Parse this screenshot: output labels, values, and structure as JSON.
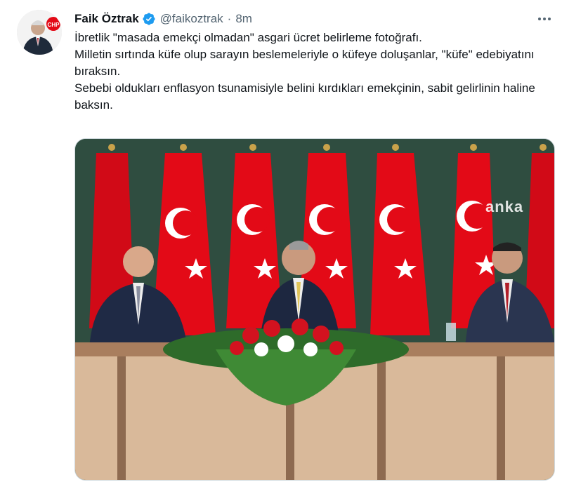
{
  "author": {
    "name": "Faik Öztrak",
    "handle": "@faikoztrak",
    "time": "8m",
    "separator": "·",
    "avatar_badge": "CHP",
    "verified": true
  },
  "tweet": {
    "lines": [
      "İbretlik \"masada emekçi olmadan\" asgari ücret belirleme fotoğrafı.",
      "Milletin sırtında küfe olup sarayın beslemeleriyle o küfeye doluşanlar, \"küfe\" edebiyatını bıraksın.",
      "Sebebi oldukları enflasyon tsunamisiyle belini kırdıkları emekçinin, sabit gelirlinin haline baksın."
    ]
  },
  "media": {
    "watermark": "anka"
  },
  "colors": {
    "verified": "#1d9bf0",
    "flag_red": "#e30a17",
    "backdrop": "#2c4a3c",
    "table": "#d9b99a"
  },
  "icons": {
    "more": "more-horizontal-icon",
    "verified": "verified-badge-icon"
  }
}
